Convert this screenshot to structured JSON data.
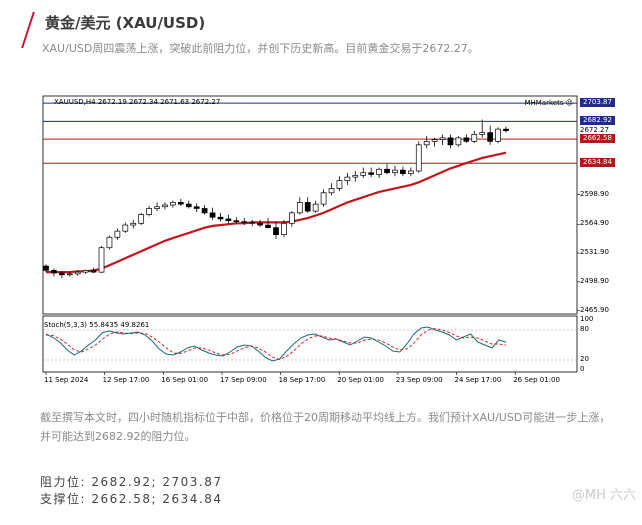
{
  "header": {
    "title": "黄金/美元 (XAU/USD)",
    "subtitle": "XAU/USD周四震荡上涨，突破此前阻力位，并创下历史新高。目前黄金交易于2672.27。"
  },
  "chart_data": {
    "type": "candlestick",
    "symbol_info": "XAUUSD,H4  2672.19 2672.34 2671.63 2672.27",
    "brand": "MHMarkets",
    "y_ticks": [
      "2465.90",
      "2498.90",
      "2531.90",
      "2564.90",
      "2598.90"
    ],
    "ylim": [
      2462,
      2712
    ],
    "x_labels": [
      "11 Sep 2024",
      "12 Sep 17:00",
      "16 Sep 01:00",
      "17 Sep 09:00",
      "18 Sep 17:00",
      "20 Sep 01:00",
      "23 Sep 09:00",
      "24 Sep 17:00",
      "26 Sep 01:00"
    ],
    "ohlc": [
      [
        2517,
        2519,
        2510,
        2512
      ],
      [
        2512,
        2514,
        2505,
        2509
      ],
      [
        2509,
        2511,
        2503,
        2507
      ],
      [
        2507,
        2510,
        2505,
        2508
      ],
      [
        2508,
        2512,
        2506,
        2510
      ],
      [
        2510,
        2513,
        2508,
        2512
      ],
      [
        2512,
        2515,
        2509,
        2510
      ],
      [
        2510,
        2540,
        2509,
        2538
      ],
      [
        2538,
        2552,
        2536,
        2550
      ],
      [
        2550,
        2560,
        2547,
        2557
      ],
      [
        2557,
        2567,
        2555,
        2564
      ],
      [
        2564,
        2570,
        2560,
        2566
      ],
      [
        2566,
        2578,
        2564,
        2576
      ],
      [
        2576,
        2586,
        2574,
        2583
      ],
      [
        2583,
        2590,
        2580,
        2585
      ],
      [
        2585,
        2590,
        2582,
        2587
      ],
      [
        2587,
        2592,
        2584,
        2590
      ],
      [
        2590,
        2594,
        2586,
        2588
      ],
      [
        2588,
        2592,
        2583,
        2585
      ],
      [
        2585,
        2589,
        2579,
        2583
      ],
      [
        2583,
        2587,
        2576,
        2578
      ],
      [
        2578,
        2584,
        2570,
        2573
      ],
      [
        2573,
        2578,
        2568,
        2571
      ],
      [
        2571,
        2576,
        2566,
        2569
      ],
      [
        2569,
        2573,
        2565,
        2568
      ],
      [
        2568,
        2572,
        2564,
        2567
      ],
      [
        2567,
        2570,
        2563,
        2566
      ],
      [
        2566,
        2570,
        2562,
        2564
      ],
      [
        2564,
        2572,
        2560,
        2561
      ],
      [
        2561,
        2568,
        2548,
        2553
      ],
      [
        2553,
        2570,
        2550,
        2566
      ],
      [
        2566,
        2580,
        2562,
        2578
      ],
      [
        2578,
        2596,
        2576,
        2590
      ],
      [
        2590,
        2596,
        2578,
        2580
      ],
      [
        2580,
        2592,
        2578,
        2588
      ],
      [
        2588,
        2605,
        2585,
        2601
      ],
      [
        2601,
        2612,
        2598,
        2606
      ],
      [
        2606,
        2620,
        2603,
        2615
      ],
      [
        2615,
        2624,
        2610,
        2619
      ],
      [
        2619,
        2626,
        2614,
        2621
      ],
      [
        2621,
        2630,
        2618,
        2624
      ],
      [
        2624,
        2630,
        2619,
        2622
      ],
      [
        2622,
        2630,
        2618,
        2628
      ],
      [
        2628,
        2634,
        2622,
        2624
      ],
      [
        2624,
        2632,
        2620,
        2627
      ],
      [
        2627,
        2631,
        2620,
        2623
      ],
      [
        2623,
        2630,
        2620,
        2626
      ],
      [
        2626,
        2660,
        2624,
        2656
      ],
      [
        2656,
        2666,
        2652,
        2660
      ],
      [
        2660,
        2664,
        2654,
        2662
      ],
      [
        2662,
        2668,
        2656,
        2664
      ],
      [
        2664,
        2668,
        2652,
        2656
      ],
      [
        2656,
        2666,
        2654,
        2664
      ],
      [
        2664,
        2668,
        2658,
        2660
      ],
      [
        2660,
        2672,
        2658,
        2668
      ],
      [
        2668,
        2685,
        2664,
        2670
      ],
      [
        2670,
        2678,
        2656,
        2660
      ],
      [
        2660,
        2676,
        2658,
        2674
      ],
      [
        2674,
        2677,
        2670,
        2672.27
      ]
    ],
    "ma_period": 20,
    "ma_values": [
      2510,
      2510,
      2510,
      2510,
      2511,
      2511,
      2512,
      2514,
      2518,
      2522,
      2526,
      2530,
      2534,
      2538,
      2542,
      2546,
      2549,
      2552,
      2555,
      2558,
      2561,
      2563,
      2564,
      2565,
      2566,
      2566,
      2567,
      2567,
      2567,
      2567,
      2567,
      2568,
      2570,
      2572,
      2575,
      2578,
      2582,
      2586,
      2590,
      2593,
      2596,
      2599,
      2602,
      2604,
      2606,
      2608,
      2610,
      2613,
      2617,
      2621,
      2625,
      2629,
      2632,
      2635,
      2638,
      2641,
      2643,
      2645,
      2647
    ],
    "horizontal_levels": [
      {
        "value": 2703.87,
        "label": "2703.87",
        "kind": "resistance",
        "color": "#1f2a8a"
      },
      {
        "value": 2682.92,
        "label": "2682.92",
        "kind": "resistance",
        "color": "#1f2a8a"
      },
      {
        "value": 2672.27,
        "label": "2672.27",
        "kind": "price",
        "color": "#000000"
      },
      {
        "value": 2662.58,
        "label": "2662.58",
        "kind": "support",
        "color": "#b11a1a"
      },
      {
        "value": 2634.84,
        "label": "2634.84",
        "kind": "support",
        "color": "#b11a1a"
      }
    ],
    "stoch": {
      "label": "Stoch(5,3,3) 55.8435 49.8261",
      "ticks": [
        "100",
        "80",
        "20",
        "0"
      ],
      "k": [
        72,
        65,
        55,
        40,
        30,
        38,
        50,
        60,
        75,
        78,
        74,
        72,
        74,
        76,
        70,
        58,
        42,
        32,
        30,
        36,
        44,
        48,
        40,
        34,
        30,
        28,
        36,
        46,
        50,
        48,
        38,
        25,
        18,
        22,
        38,
        52,
        64,
        70,
        72,
        66,
        60,
        62,
        56,
        50,
        58,
        66,
        64,
        56,
        48,
        38,
        36,
        52,
        72,
        84,
        86,
        80,
        76,
        70,
        60,
        66,
        72,
        56,
        50,
        44,
        60,
        55.8
      ],
      "d": [
        70,
        69,
        62,
        52,
        40,
        36,
        42,
        50,
        62,
        72,
        76,
        74,
        73,
        74,
        73,
        66,
        56,
        44,
        34,
        33,
        38,
        44,
        44,
        40,
        34,
        30,
        31,
        38,
        44,
        48,
        44,
        36,
        26,
        21,
        27,
        38,
        52,
        62,
        68,
        68,
        64,
        62,
        58,
        54,
        54,
        60,
        62,
        60,
        54,
        46,
        40,
        42,
        54,
        70,
        80,
        83,
        80,
        75,
        68,
        64,
        66,
        64,
        58,
        52,
        52,
        49.8
      ]
    }
  },
  "analysis": {
    "paragraph": "截至撰写本文时，四小时随机指标位于中部，价格位于20周期移动平均线上方。我们预计XAU/USD可能进一步上涨，并可能达到2682.92的阻力位。",
    "resistance": "阻力位: 2682.92; 2703.87",
    "support": "支撑位: 2662.58; 2634.84"
  },
  "watermark": "@MH 六六"
}
